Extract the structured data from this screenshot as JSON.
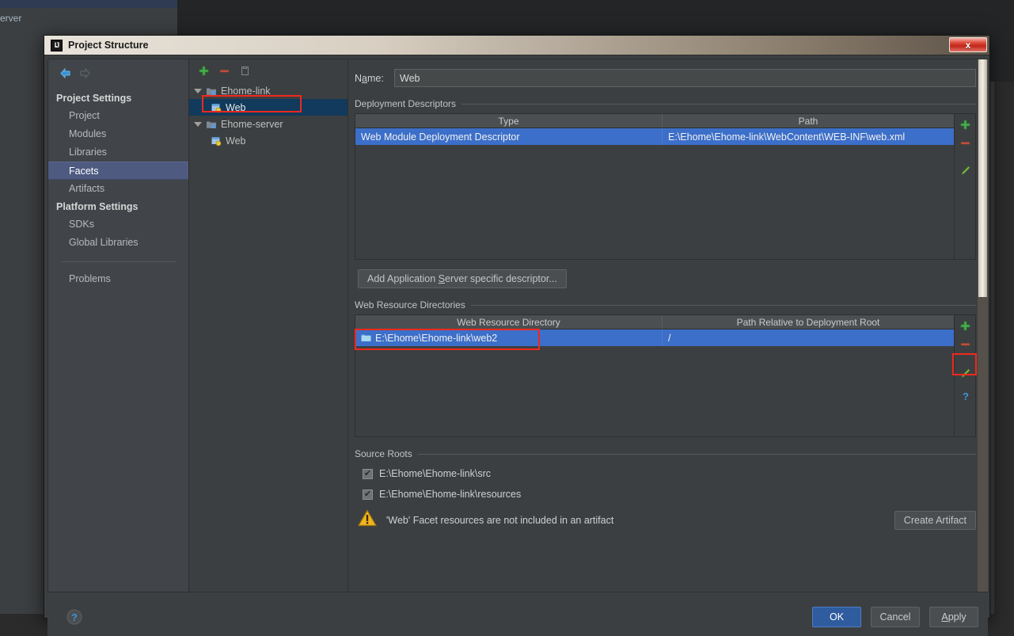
{
  "background": {
    "window_label": "erver"
  },
  "dialog": {
    "title": "Project Structure",
    "app_icon": "IJ",
    "close_label": "x"
  },
  "sidebar": {
    "back_icon": "back-arrow-icon",
    "forward_icon": "forward-arrow-icon",
    "groups": [
      {
        "label": "Project Settings",
        "items": [
          {
            "label": "Project",
            "selected": false
          },
          {
            "label": "Modules",
            "selected": false
          },
          {
            "label": "Libraries",
            "selected": false
          },
          {
            "label": "Facets",
            "selected": true
          },
          {
            "label": "Artifacts",
            "selected": false
          }
        ]
      },
      {
        "label": "Platform Settings",
        "items": [
          {
            "label": "SDKs",
            "selected": false
          },
          {
            "label": "Global Libraries",
            "selected": false
          }
        ]
      }
    ],
    "problems": {
      "label": "Problems"
    }
  },
  "tree": {
    "toolbar": [
      {
        "name": "add-facet-button",
        "icon": "plus-icon"
      },
      {
        "name": "remove-facet-button",
        "icon": "minus-icon"
      },
      {
        "name": "copy-facet-button",
        "icon": "copy-icon"
      }
    ],
    "nodes": [
      {
        "label": "Ehome-link",
        "type": "module",
        "level": 0,
        "expanded": true,
        "selected": false
      },
      {
        "label": "Web",
        "type": "facet",
        "level": 1,
        "expanded": false,
        "selected": true,
        "highlighted": true
      },
      {
        "label": "Ehome-server",
        "type": "module",
        "level": 0,
        "expanded": true,
        "selected": false
      },
      {
        "label": "Web",
        "type": "facet",
        "level": 1,
        "expanded": false,
        "selected": false,
        "highlighted": false
      }
    ]
  },
  "facet": {
    "name_label": "Name:",
    "name_label_pre": "N",
    "name_label_mnemonic": "a",
    "name_label_post": "me:",
    "name_value": "Web",
    "name_placeholder": ""
  },
  "deployment_descriptors": {
    "section_label": "Deployment Descriptors",
    "columns": [
      "Type",
      "Path"
    ],
    "rows": [
      {
        "type": "Web Module Deployment Descriptor",
        "path": "E:\\Ehome\\Ehome-link\\WebContent\\WEB-INF\\web.xml",
        "selected": true
      }
    ],
    "actions": [
      {
        "name": "add-descriptor-button",
        "icon": "plus-icon"
      },
      {
        "name": "remove-descriptor-button",
        "icon": "minus-icon"
      },
      {
        "name": "edit-descriptor-button",
        "icon": "pencil-icon"
      }
    ],
    "add_app_server_button": {
      "pre": "Add Application ",
      "mnemonic": "S",
      "post": "erver specific descriptor..."
    }
  },
  "web_resource_directories": {
    "section_label": "Web Resource Directories",
    "columns": [
      "Web Resource Directory",
      "Path Relative to Deployment Root"
    ],
    "rows": [
      {
        "directory": "E:\\Ehome\\Ehome-link\\web2",
        "relative_path": "/",
        "selected": true,
        "highlighted": true
      }
    ],
    "actions": [
      {
        "name": "add-web-resource-button",
        "icon": "plus-icon",
        "highlighted": false
      },
      {
        "name": "remove-web-resource-button",
        "icon": "minus-icon",
        "highlighted": false
      },
      {
        "name": "edit-web-resource-button",
        "icon": "pencil-icon",
        "highlighted": true
      },
      {
        "name": "help-web-resource-button",
        "icon": "question-icon",
        "highlighted": false
      }
    ]
  },
  "source_roots": {
    "section_label": "Source Roots",
    "items": [
      {
        "label": "E:\\Ehome\\Ehome-link\\src",
        "checked": true,
        "check_glyph": "✔"
      },
      {
        "label": "E:\\Ehome\\Ehome-link\\resources",
        "checked": true,
        "check_glyph": "✔"
      }
    ]
  },
  "warning": {
    "icon": "warning-triangle-icon",
    "text": "'Web' Facet resources are not included in an artifact",
    "action_label": "Create Artifact"
  },
  "footer": {
    "help_icon": "help-question-icon",
    "ok_label": "OK",
    "cancel_label": "Cancel",
    "apply_pre": "A",
    "apply_mnemonic": "",
    "apply_label": "Apply"
  },
  "colors": {
    "dialog_bg": "#3c3f41",
    "sidebar_bg": "#41454a",
    "selection_blue": "#4e5a80",
    "tree_selection": "#113a5c",
    "table_selection": "#3c6fc9",
    "highlight_red": "#f0281e",
    "accent_green": "#47b04b",
    "accent_warning": "#f0b41e",
    "primary_button": "#2f5c9e"
  }
}
